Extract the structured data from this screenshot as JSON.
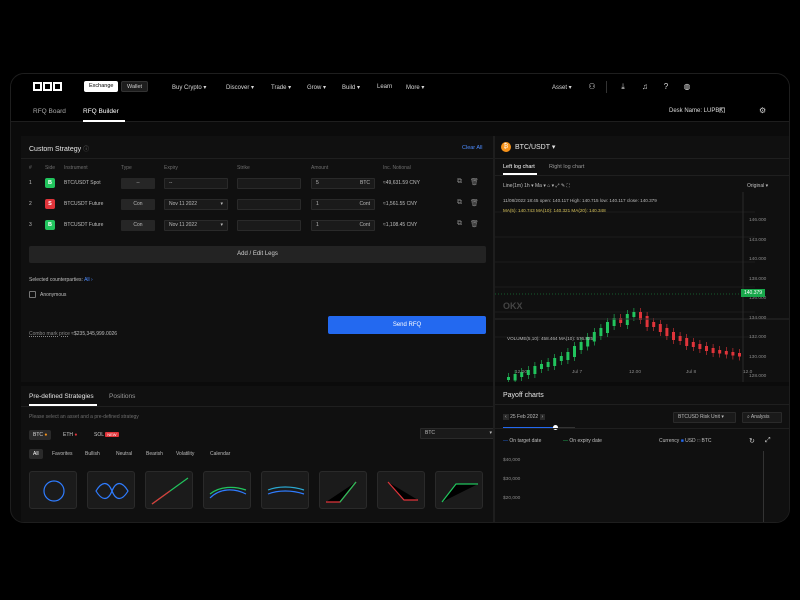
{
  "nav": {
    "exchange": "Exchange",
    "wallet": "Wallet",
    "items": [
      "Buy Crypto",
      "Discover",
      "Trade",
      "Grow",
      "Build",
      "Learn",
      "More"
    ],
    "asset": "Asset"
  },
  "subnav": {
    "tabs": [
      "RFQ Board",
      "RFQ Builder"
    ],
    "desk": "Desk Name: LUPBK"
  },
  "strategy": {
    "title": "Custom Strategy",
    "clear": "Clear All",
    "headers": [
      "#",
      "Side",
      "Instrument",
      "Type",
      "Expiry",
      "Strike",
      "Amount",
      "Inc. Notional"
    ],
    "rows": [
      {
        "n": "1",
        "side": "B",
        "instrument": "BTC/USDT Spot",
        "type": "--",
        "expiry": "--",
        "strike": "",
        "amount": "5",
        "unit": "BTC",
        "notional": "≈49,631.59 CNY"
      },
      {
        "n": "2",
        "side": "S",
        "instrument": "BTCUSDT Future",
        "type": "Con",
        "expiry": "Nov 11 2022",
        "strike": "",
        "amount": "1",
        "unit": "Cont",
        "notional": "≈1,561.55 CNY"
      },
      {
        "n": "3",
        "side": "B",
        "instrument": "BTCUSDT Future",
        "type": "Con",
        "expiry": "Nov 11 2022",
        "strike": "",
        "amount": "1",
        "unit": "Cont",
        "notional": "≈1,108.45 CNY"
      }
    ],
    "add_legs": "Add / Edit Legs",
    "counterparties_label": "Selected counterparties",
    "counterparties_value": "All",
    "anonymous": "Anonymous",
    "combo_label": "Combo mark price",
    "combo_value": "≈$235,345,999.0026",
    "send": "Send RFQ"
  },
  "predefined": {
    "tabs": [
      "Pre-defined Strategies",
      "Positions"
    ],
    "hint": "Please select an asset and a pre-defined strategy",
    "assets": [
      "BTC",
      "ETH",
      "SOL"
    ],
    "sol_badge": "NEW",
    "select": "BTC",
    "filters": [
      "All",
      "Favorites",
      "Bullish",
      "Neutral",
      "Bearish",
      "Volatility",
      "Calendar"
    ]
  },
  "chart": {
    "pair": "BTC/USDT",
    "tabs": [
      "Left log chart",
      "Right log chart"
    ],
    "timeframe": "Line(1m)",
    "interval": "1h",
    "ma": "Ma",
    "original": "Original",
    "ohlc": "11/08/2022 18:45  open: 140.117  High: 140.715  low: 140.117  close: 140.379",
    "ma_line": "MA(5): 140.743   MA(10): 140.321   MA(20): 140.348",
    "volume": "VOLUME(5,10): 458.464   MA(10): 576.825",
    "price_ticks": [
      "146.000",
      "143.000",
      "140.000",
      "138.000",
      "136.000",
      "134.000",
      "132.000",
      "130.000",
      "128.000",
      "126.000"
    ],
    "current_price": "140.379",
    "time_ticks": [
      "12.00",
      "Jul 7",
      "12.00",
      "Jul 8",
      "12.0"
    ],
    "watermark": "OKX"
  },
  "payoff": {
    "title": "Payoff charts",
    "date": "25 Feb 2022",
    "unit_select": "BTCUSD Risk Unit",
    "analysis": "Analysis",
    "legend_target": "On target date",
    "legend_expiry": "On expiry date",
    "currency": "Currency",
    "usd": "USD",
    "btc": "BTC",
    "y_ticks": [
      "$40,000",
      "$30,000",
      "$20,000"
    ]
  },
  "colors": {
    "accent": "#2369f0",
    "up": "#21c45d",
    "down": "#e0343a"
  }
}
